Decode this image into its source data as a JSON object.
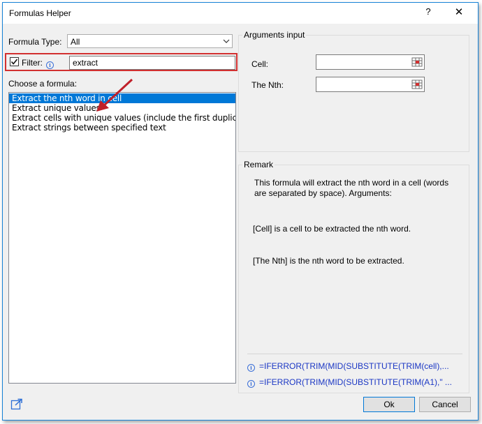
{
  "window": {
    "title": "Formulas Helper",
    "help_label": "?",
    "close_label": "✕"
  },
  "formula_type": {
    "label": "Formula Type:",
    "value": "All"
  },
  "filter": {
    "label": "Filter:",
    "checked": true,
    "value": "extract"
  },
  "choose": {
    "label": "Choose a formula:",
    "items": [
      "Extract the nth word in cell",
      "Extract unique values",
      "Extract cells with unique values (include the first duplicate",
      "Extract strings between specified text"
    ],
    "selected_index": 0
  },
  "arguments": {
    "caption": "Arguments input",
    "cell_label": "Cell:",
    "nth_label": "The Nth:"
  },
  "remark": {
    "caption": "Remark",
    "line1": "This formula will extract the nth word in a cell (words",
    "line2": "are separated by space). Arguments:",
    "cell_desc": "[Cell] is a cell to be extracted the nth word.",
    "nth_desc": "[The Nth] is the nth word to be extracted.",
    "formula1": "=IFERROR(TRIM(MID(SUBSTITUTE(TRIM(cell),...",
    "formula2": "=IFERROR(TRIM(MID(SUBSTITUTE(TRIM(A1),\" ..."
  },
  "buttons": {
    "ok": "Ok",
    "cancel": "Cancel"
  },
  "icons": {
    "share": "share-icon",
    "range": "range-select-icon",
    "info": "info-icon",
    "annotation": "red-arrow-annotation"
  },
  "colors": {
    "accent": "#0078d7",
    "formula": "#1b37c4",
    "highlight": "#d23030"
  }
}
